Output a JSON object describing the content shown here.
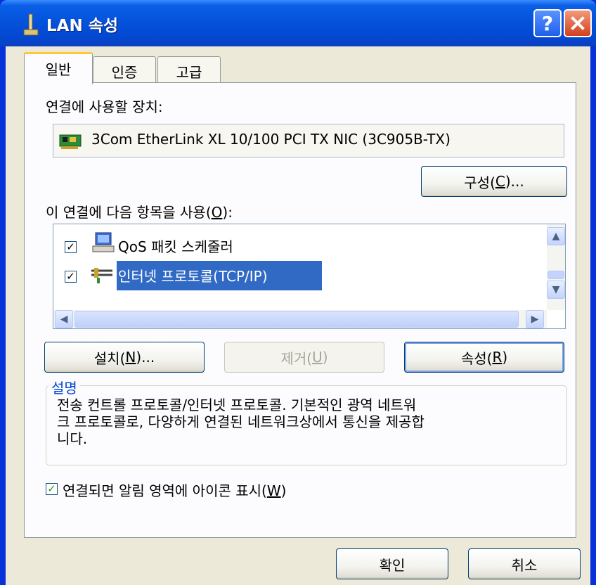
{
  "window": {
    "title": "LAN 속성",
    "help_label": "?",
    "close_label": "×"
  },
  "tabs": [
    {
      "label": "일반",
      "active": true
    },
    {
      "label": "인증",
      "active": false
    },
    {
      "label": "고급",
      "active": false
    }
  ],
  "general": {
    "device_label": "연결에 사용할 장치:",
    "device_name": "3Com EtherLink XL 10/100 PCI TX NIC (3C905B-TX)",
    "configure_button": {
      "text": "구성(",
      "key": "C",
      "suffix": ")..."
    },
    "items_label": {
      "text": "이 연결에 다음 항목을 사용(",
      "key": "O",
      "suffix": "):"
    },
    "items": [
      {
        "label": "QoS 패킷 스케줄러",
        "checked": true,
        "icon": "qos-computer-icon"
      },
      {
        "label": "인터넷 프로토콜(TCP/IP)",
        "checked": true,
        "icon": "network-protocol-icon",
        "selected": true
      }
    ],
    "install_button": {
      "text": "설치(",
      "key": "N",
      "suffix": ")..."
    },
    "uninstall_button": {
      "text": "제거(",
      "key": "U",
      "suffix": ")"
    },
    "properties_button": {
      "text": "속성(",
      "key": "R",
      "suffix": ")"
    },
    "description_title": "설명",
    "description_line1": "전송 컨트롤 프로토콜/인터넷 프로토콜. 기본적인 광역 네트워",
    "description_line2": "크 프로토콜로, 다양하게 연결된 네트워크상에서 통신을 제공합",
    "description_line3": "니다.",
    "notify": {
      "text": "연결되면 알림 영역에 아이콘 표시(",
      "key": "W",
      "suffix": ")",
      "checked": true
    }
  },
  "footer": {
    "ok_label": "확인",
    "cancel_label": "취소"
  },
  "colors": {
    "title_bar": "#0453dc",
    "selection": "#316ac5",
    "face": "#ece9d8",
    "group_title": "#0046d5"
  }
}
